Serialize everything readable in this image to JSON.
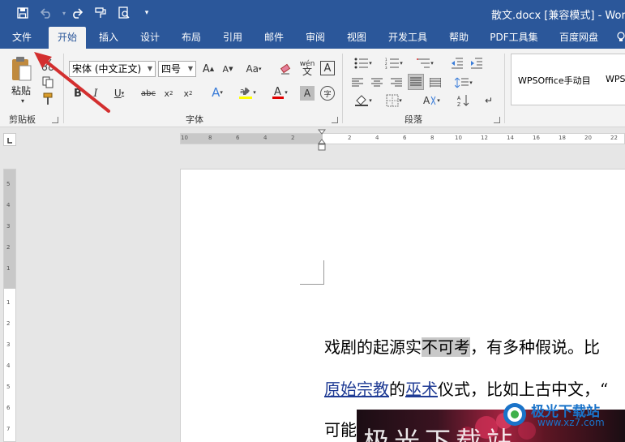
{
  "window": {
    "title": "散文.docx [兼容模式] - Word"
  },
  "tabs": [
    "文件",
    "开始",
    "插入",
    "设计",
    "布局",
    "引用",
    "邮件",
    "审阅",
    "视图",
    "开发工具",
    "帮助",
    "PDF工具集",
    "百度网盘"
  ],
  "active_tab": "开始",
  "ribbon": {
    "clipboard": {
      "label": "剪贴板",
      "paste_label": "粘贴"
    },
    "font": {
      "label": "字体",
      "font_name": "宋体 (中文正文)",
      "font_size": "四号"
    },
    "paragraph": {
      "label": "段落"
    },
    "styles": {
      "style_1": "WPSOffice手动目",
      "style_2": "WPS"
    }
  },
  "ruler": {
    "horizontal_labels": [
      "10",
      "8",
      "6",
      "4",
      "2",
      "2",
      "4",
      "6",
      "8",
      "10",
      "12",
      "14",
      "16",
      "18",
      "20",
      "22"
    ],
    "vertical_labels": [
      "5",
      "4",
      "3",
      "2",
      "1",
      "1",
      "2",
      "3",
      "4",
      "5",
      "6",
      "7"
    ]
  },
  "document": {
    "line1": {
      "before": "戏剧的起源实",
      "highlighted": "不可考",
      "after": "，有多种假说。比"
    },
    "line2": {
      "link1": "原始宗教",
      "mid1": "的",
      "link2": "巫术",
      "after": "仪式，比如上古中文，“"
    },
    "line3": {
      "text": "可能"
    }
  },
  "overlay": {
    "text": "极光下载站"
  },
  "watermark": {
    "text": "极光下载站",
    "url": "www.xz7.com"
  },
  "colors": {
    "titlebar": "#2b579a",
    "ribbon": "#f3f3f3",
    "annotation_arrow": "#d32f2f"
  }
}
